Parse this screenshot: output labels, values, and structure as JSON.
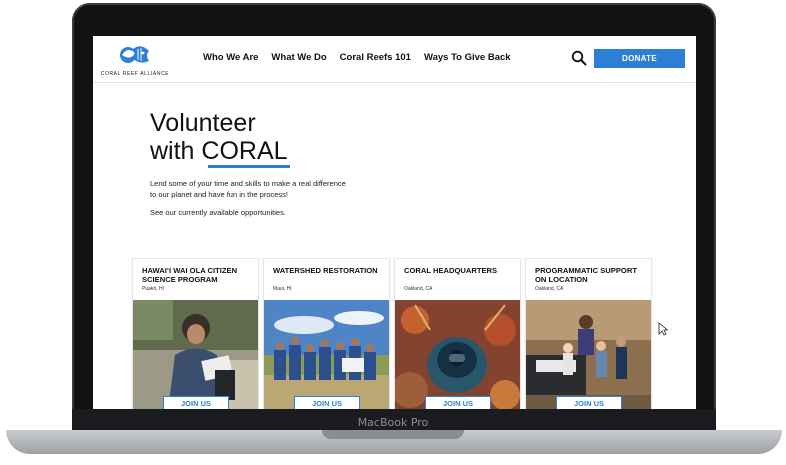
{
  "device": {
    "label": "MacBook Pro"
  },
  "site": {
    "logo_text": "CORAL REEF ALLIANCE",
    "nav": [
      "Who We Are",
      "What We Do",
      "Coral Reefs 101",
      "Ways To Give Back"
    ],
    "search_icon": "search-icon",
    "donate_label": "DONATE",
    "accent_color": "#2d7fd6"
  },
  "hero": {
    "title_line1": "Volunteer",
    "title_with": "with ",
    "title_coral": "CORAL",
    "body": "Lend some of your time and skills to make a real difference to our planet and have fun in the process!",
    "body2": "See our currently available opportunities."
  },
  "cards": [
    {
      "title": "HAWAI‘I WAI OLA CITIZEN SCIENCE PROGRAM",
      "location": "Puakō, HI",
      "button": "JOIN US"
    },
    {
      "title": "WATERSHED RESTORATION",
      "location": "Maui, HI",
      "button": "JOIN US"
    },
    {
      "title": "CORAL HEADQUARTERS",
      "location": "Oakland, CA",
      "button": "JOIN US"
    },
    {
      "title": "PROGRAMMATIC SUPPORT ON LOCATION",
      "location": "Oakland, CA",
      "button": "JOIN US"
    }
  ]
}
